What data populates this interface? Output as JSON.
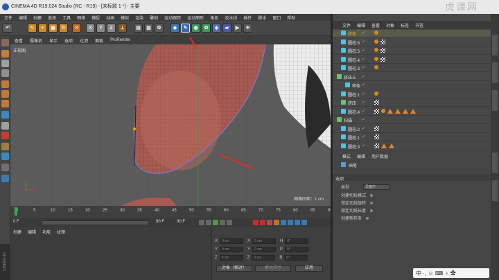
{
  "window": {
    "title": "CINEMA 4D R19.024 Studio (RC - R19) - [未标题 1 *] - 主要",
    "watermark": "虎课网"
  },
  "menu": [
    "文件",
    "编辑",
    "创建",
    "选择",
    "工具",
    "网格",
    "捕捉",
    "动画",
    "模拟",
    "渲染",
    "雕刻",
    "运动跟踪",
    "运动图形",
    "角色",
    "流水线",
    "插件",
    "脚本",
    "窗口",
    "帮助"
  ],
  "toolbar": {
    "axes": [
      "X",
      "Y",
      "Z"
    ]
  },
  "viewport": {
    "menu": [
      "查看",
      "摄像机",
      "显示",
      "选项",
      "过滤",
      "面板",
      "ProRender"
    ],
    "label": "正视图",
    "grid_info": "网格间距：1 cm"
  },
  "timeline": {
    "ticks": [
      "0",
      "5",
      "10",
      "15",
      "20",
      "25",
      "30",
      "35",
      "40",
      "45",
      "50",
      "55",
      "60",
      "65",
      "70",
      "75",
      "80",
      "85",
      "90"
    ],
    "start": "0 F",
    "current": "0 F",
    "end": "90 F",
    "end2": "90 F"
  },
  "anim": {
    "tabs": [
      "创建",
      "编辑",
      "功能",
      "纹理"
    ]
  },
  "coords": {
    "rows": [
      {
        "a": "X",
        "av": "0 cm",
        "b": "X",
        "bv": "0 cm",
        "c": "H",
        "cv": "0°"
      },
      {
        "a": "Y",
        "av": "0 cm",
        "b": "Y",
        "bv": "0 cm",
        "c": "P",
        "cv": "0°"
      },
      {
        "a": "Z",
        "av": "0 cm",
        "b": "Z",
        "bv": "0 cm",
        "c": "B",
        "cv": "0°"
      }
    ],
    "mode1": "对象（相对）",
    "mode2": "绝对尺寸",
    "apply": "应用"
  },
  "objects": {
    "tabs": [
      "文件",
      "编辑",
      "查看",
      "对象",
      "标签",
      "书签"
    ],
    "rows": [
      {
        "name": "样条",
        "sel": true,
        "icon": "#55c0e0",
        "indent": 12,
        "tags": [
          "dot"
        ]
      },
      {
        "name": "圆柱.6",
        "sel": false,
        "icon": "#55c0e0",
        "indent": 12,
        "tags": [
          "dot",
          "chk"
        ]
      },
      {
        "name": "圆柱.5",
        "sel": false,
        "icon": "#55c0e0",
        "indent": 12,
        "tags": [
          "dot",
          "chk"
        ]
      },
      {
        "name": "圆柱.4",
        "sel": false,
        "icon": "#55c0e0",
        "indent": 12,
        "tags": [
          "dot",
          "chk"
        ]
      },
      {
        "name": "圆柱.3",
        "sel": false,
        "icon": "#55c0e0",
        "indent": 12,
        "tags": [
          "dot"
        ]
      },
      {
        "name": "挤压.5",
        "sel": false,
        "icon": "#6cc070",
        "indent": 6,
        "tags": []
      },
      {
        "name": "样条",
        "sel": false,
        "icon": "#55c0e0",
        "indent": 18,
        "tags": []
      },
      {
        "name": "圆柱.1",
        "sel": false,
        "icon": "#55c0e0",
        "indent": 12,
        "tags": [
          "dot"
        ]
      },
      {
        "name": "挤压",
        "sel": false,
        "icon": "#6cc070",
        "indent": 12,
        "tags": [
          "chk"
        ]
      },
      {
        "name": "圆柱.4",
        "sel": false,
        "icon": "#55c0e0",
        "indent": 12,
        "tags": [
          "chk",
          "dot",
          "tri",
          "tri",
          "tri",
          "tri"
        ]
      },
      {
        "name": "扫描",
        "sel": false,
        "icon": "#6cc070",
        "indent": 6,
        "tags": []
      },
      {
        "name": "圆柱.2",
        "sel": false,
        "icon": "#55c0e0",
        "indent": 12,
        "tags": [
          "chk"
        ]
      },
      {
        "name": "圆柱.1",
        "sel": false,
        "icon": "#55c0e0",
        "indent": 12,
        "tags": [
          "chk"
        ]
      },
      {
        "name": "圆柱.3",
        "sel": false,
        "icon": "#55c0e0",
        "indent": 12,
        "tags": [
          "chk",
          "tri",
          "tri"
        ]
      }
    ]
  },
  "attributes": {
    "tabs": [
      "模式",
      "编辑",
      "用户数据"
    ],
    "object_label": "画笔",
    "section": "选项",
    "type_label": "类型",
    "type_value": "贝塞尔",
    "options": [
      "创建切线模式",
      "锁定切线旋转",
      "锁定切线长度",
      "创建新样条"
    ]
  },
  "brand": "CINEMA 4D",
  "ime": "中 ·, ☺ ⌨ ♀ ✿"
}
